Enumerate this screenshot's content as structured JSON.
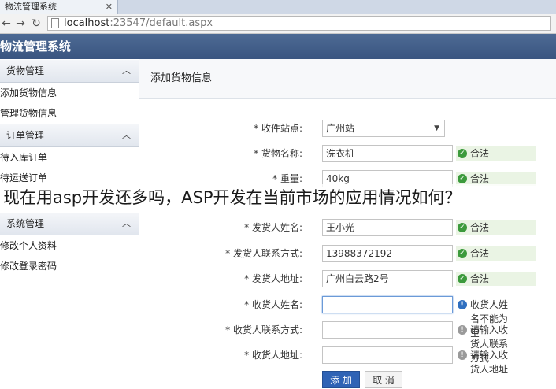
{
  "browser": {
    "tab_title": "物流管理系统",
    "url_host": "localhost",
    "url_rest": ":23547/default.aspx"
  },
  "app": {
    "title": "物流管理系统"
  },
  "sidebar": {
    "sections": [
      {
        "label": "货物管理",
        "items": [
          "添加货物信息",
          "管理货物信息"
        ]
      },
      {
        "label": "订单管理",
        "items": [
          "待入库订单",
          "待运送订单"
        ]
      },
      {
        "label": "系统管理",
        "items": [
          "修改个人资料",
          "修改登录密码"
        ]
      }
    ]
  },
  "main": {
    "title": "添加货物信息",
    "form": {
      "station": {
        "label": "* 收件站点:",
        "value": "广州站"
      },
      "goods_name": {
        "label": "* 货物名称:",
        "value": "洗衣机",
        "status": "合法"
      },
      "weight": {
        "label": "* 重量:",
        "value": "40kg",
        "status": "合法"
      },
      "sender_name": {
        "label": "* 发货人姓名:",
        "value": "王小光",
        "status": "合法"
      },
      "sender_phone": {
        "label": "* 发货人联系方式:",
        "value": "13988372192",
        "status": "合法"
      },
      "sender_address": {
        "label": "* 发货人地址:",
        "value": "广州白云路2号",
        "status": "合法"
      },
      "receiver_name": {
        "label": "* 收货人姓名:",
        "value": "",
        "status": "收货人姓名不能为空"
      },
      "receiver_phone": {
        "label": "* 收货人联系方式:",
        "value": "",
        "status": "请输入收货人联系方式"
      },
      "receiver_address": {
        "label": "* 收货人地址:",
        "value": "",
        "status": "请输入收货人地址"
      }
    },
    "buttons": {
      "add": "添 加",
      "cancel": "取 消"
    }
  },
  "overlay_caption": "现在用asp开发还多吗，ASP开发在当前市场的应用情况如何？",
  "colors": {
    "header": "#3a5580",
    "primary_button": "#2f63b5",
    "ok_icon": "#3c9a3c",
    "error_icon": "#2f6fc0"
  }
}
